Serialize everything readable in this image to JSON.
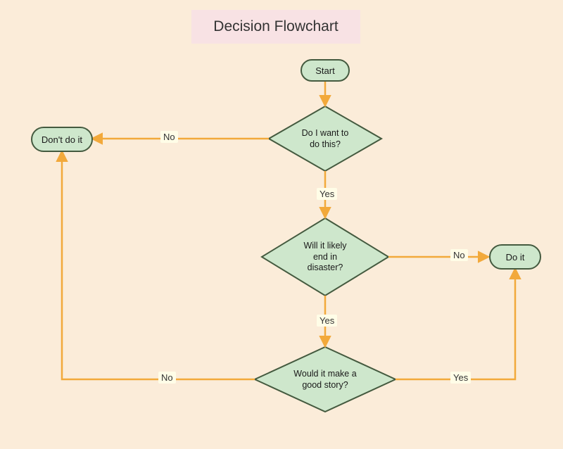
{
  "title": "Decision Flowchart",
  "nodes": {
    "start": {
      "label": "Start"
    },
    "dont": {
      "label": "Don't do it"
    },
    "doit": {
      "label": "Do it"
    },
    "want": {
      "label": "Do I want to\ndo this?"
    },
    "disaster": {
      "label": "Will it likely\nend in\ndisaster?"
    },
    "story": {
      "label": "Would it make a\ngood story?"
    }
  },
  "edges": {
    "yes1": "Yes",
    "no1": "No",
    "yes2": "Yes",
    "no2": "No",
    "yes3": "Yes",
    "no3": "No"
  },
  "colors": {
    "background": "#fbecd9",
    "titlebg": "#f8e2e4",
    "fill": "#cee7cc",
    "stroke": "#445a3f",
    "edge": "#f2a93b",
    "labelbg": "#fffde7"
  }
}
